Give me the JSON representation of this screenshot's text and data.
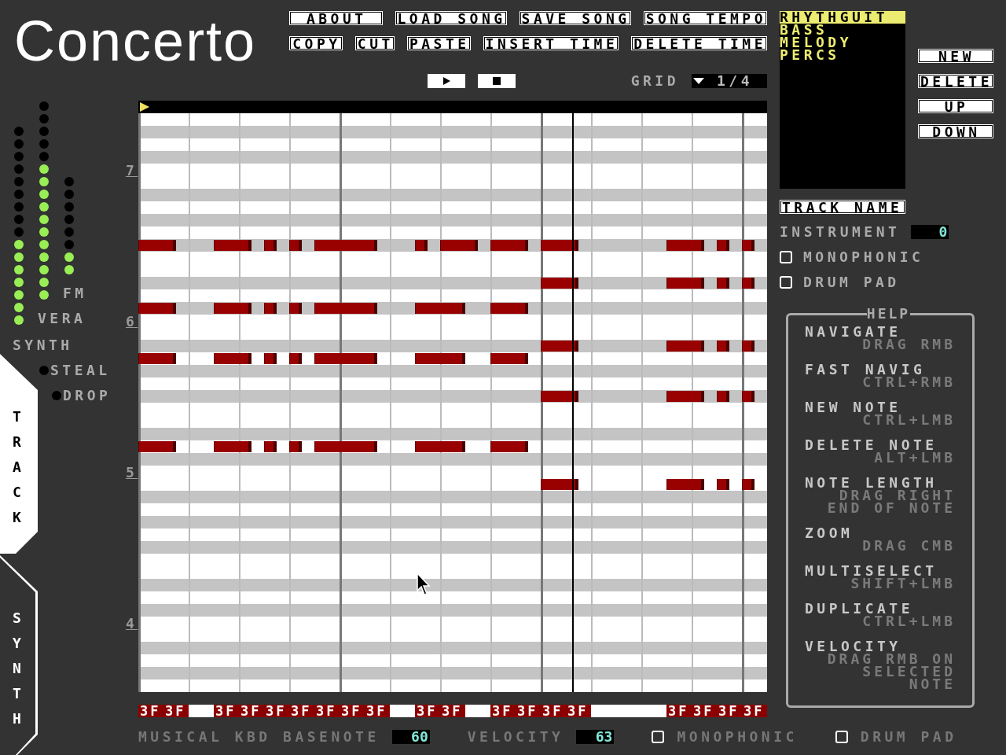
{
  "logo": {
    "text": "Concerto"
  },
  "menu": [
    [
      "ABOUT",
      "LOAD SONG",
      "SAVE SONG",
      "SONG TEMPO"
    ],
    [
      "COPY",
      "CUT",
      "PASTE",
      "INSERT TIME",
      "DELETE TIME"
    ]
  ],
  "transport": [
    {
      "kind": "play"
    },
    {
      "kind": "stop"
    }
  ],
  "grid": {
    "label": "GRID",
    "value": "1/4"
  },
  "tracks": [
    {
      "name": "RHYTHGUIT",
      "selected": true
    },
    {
      "name": "BASS",
      "selected": false
    },
    {
      "name": "MELODY",
      "selected": false
    },
    {
      "name": "PERCS",
      "selected": false
    }
  ],
  "track_buttons": [
    "NEW",
    "DELETE",
    "UP",
    "DOWN"
  ],
  "track_name": {
    "value": "TRACK NAME"
  },
  "instrument": {
    "label": "INSTRUMENT",
    "value": "0"
  },
  "track_options": [
    {
      "label": "MONOPHONIC",
      "checked": false
    },
    {
      "label": "DRUM PAD",
      "checked": false
    }
  ],
  "help": {
    "title": "HELP",
    "items": [
      {
        "action": "NAVIGATE",
        "hint_lines": [
          "DRAG RMB"
        ]
      },
      {
        "action": "FAST NAVIG",
        "hint_lines": [
          "CTRL+RMB"
        ]
      },
      {
        "action": "NEW NOTE",
        "hint_lines": [
          "CTRL+LMB"
        ]
      },
      {
        "action": "DELETE NOTE",
        "hint_lines": [
          "ALT+LMB"
        ]
      },
      {
        "action": "NOTE LENGTH",
        "hint_lines": [
          "DRAG RIGHT",
          "END OF NOTE"
        ]
      },
      {
        "action": "ZOOM",
        "hint_lines": [
          "DRAG CMB"
        ]
      },
      {
        "action": "MULTISELECT",
        "hint_lines": [
          "SHIFT+LMB"
        ]
      },
      {
        "action": "DUPLICATE",
        "hint_lines": [
          "CTRL+LMB"
        ]
      },
      {
        "action": "VELOCITY",
        "hint_lines": [
          "DRAG RMB ON",
          "SELECTED",
          "NOTE"
        ]
      }
    ]
  },
  "meters": [
    {
      "level": 0.25
    },
    {
      "label": "FM",
      "level": 0.6875
    },
    {
      "label": "VERA",
      "level": 0.4375
    }
  ],
  "synth_section": {
    "label": "SYNTH"
  },
  "voice_modes": [
    {
      "label": "STEAL",
      "on": false
    },
    {
      "label": "DROP",
      "on": false
    }
  ],
  "side_tabs": [
    {
      "label": "TRACK",
      "selected": true
    },
    {
      "label": "SYNTH",
      "selected": false
    }
  ],
  "octave_labels": [
    "7",
    "6",
    "5",
    "4"
  ],
  "velocity_strip": [
    {
      "kind": "value",
      "text": "3F"
    },
    {
      "kind": "value",
      "text": "3F"
    },
    {
      "kind": "empty"
    },
    {
      "kind": "value",
      "text": "3F"
    },
    {
      "kind": "value",
      "text": "3F"
    },
    {
      "kind": "value",
      "text": "3F"
    },
    {
      "kind": "value",
      "text": "3F"
    },
    {
      "kind": "value",
      "text": "3F"
    },
    {
      "kind": "value",
      "text": "3F"
    },
    {
      "kind": "value",
      "text": "3F"
    },
    {
      "kind": "empty"
    },
    {
      "kind": "value",
      "text": "3F"
    },
    {
      "kind": "value",
      "text": "3F"
    },
    {
      "kind": "empty"
    },
    {
      "kind": "value",
      "text": "3F"
    },
    {
      "kind": "value",
      "text": "3F"
    },
    {
      "kind": "value",
      "text": "3F"
    },
    {
      "kind": "value",
      "text": "3F"
    },
    {
      "kind": "empty"
    },
    {
      "kind": "empty"
    },
    {
      "kind": "empty"
    },
    {
      "kind": "value",
      "text": "3F"
    },
    {
      "kind": "value",
      "text": "3F"
    },
    {
      "kind": "value",
      "text": "3F"
    },
    {
      "kind": "value",
      "text": "3F"
    }
  ],
  "bottom_bar": {
    "basenote": {
      "label": "MUSICAL KBD BASENOTE",
      "value": "60"
    },
    "velocity": {
      "label": "VELOCITY",
      "value": "63"
    },
    "options": [
      {
        "label": "MONOPHONIC",
        "checked": false
      },
      {
        "label": "DRUM PAD",
        "checked": false
      }
    ]
  }
}
